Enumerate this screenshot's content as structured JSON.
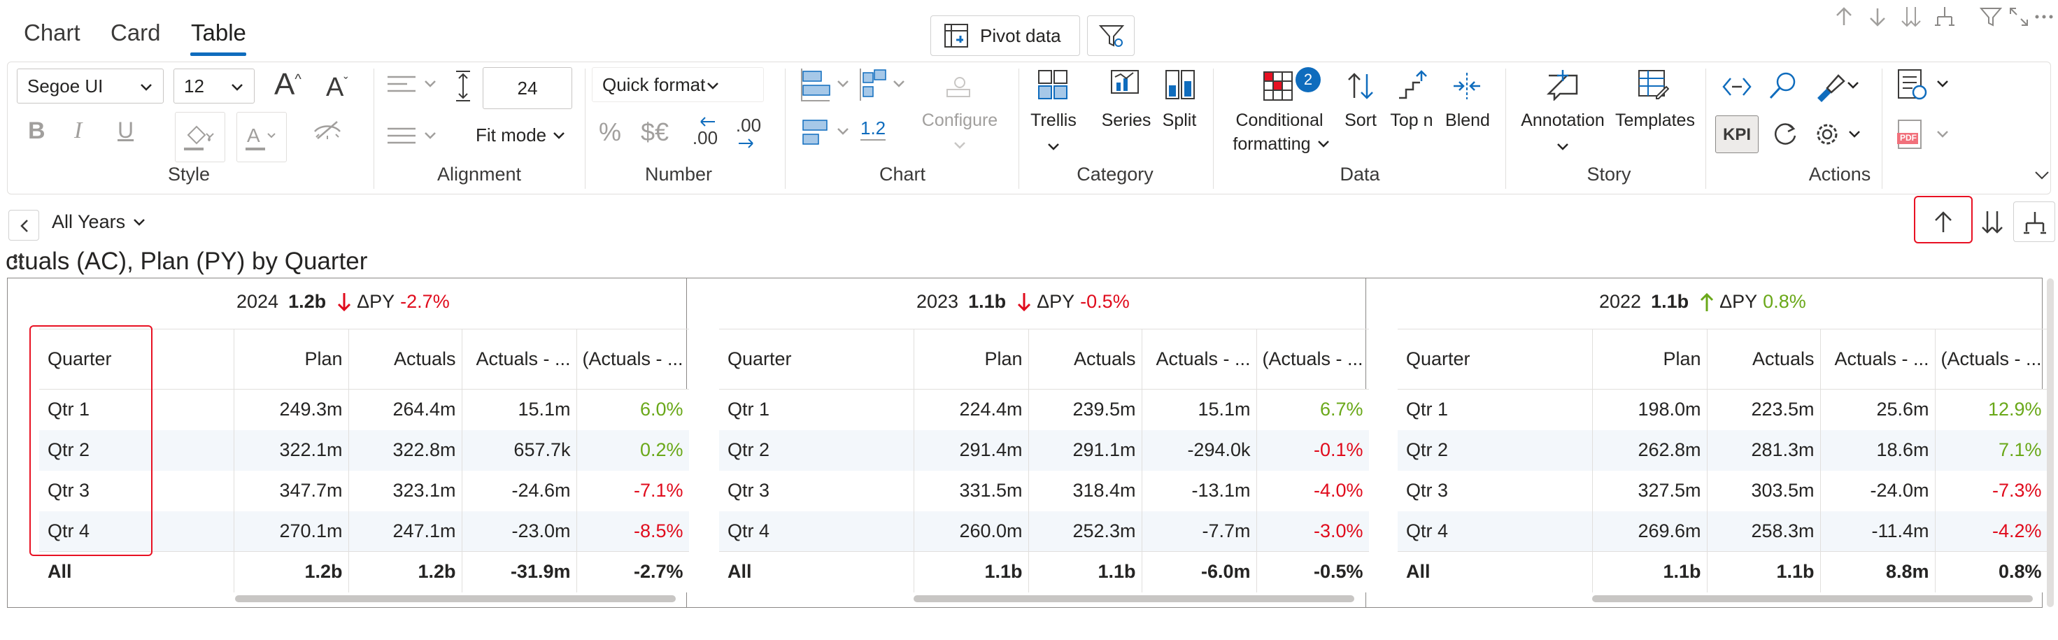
{
  "tabs": [
    {
      "label": "Chart",
      "active": false
    },
    {
      "label": "Card",
      "active": false
    },
    {
      "label": "Table",
      "active": true
    }
  ],
  "top_toolbar": {
    "pivot_label": "Pivot data",
    "tiny_icons": [
      "arrow-up-icon",
      "arrow-down-icon",
      "sort-down-icon",
      "hierarchy-icon",
      "filter-icon",
      "expand-icon",
      "more-icon"
    ]
  },
  "ribbon": {
    "style": {
      "label": "Style",
      "font_family": "Segoe UI",
      "font_size": "12",
      "bold": "B",
      "italic": "I",
      "underline": "U"
    },
    "alignment": {
      "label": "Alignment",
      "row_height": "24",
      "fit_mode": "Fit mode"
    },
    "number": {
      "label": "Number",
      "quick_format": "Quick format",
      "percent": "%",
      "currency": "$€",
      "dec_less": ".00",
      "dec_more": ".00"
    },
    "chart": {
      "label": "Chart",
      "scale_value": "1.2",
      "configure": "Configure"
    },
    "category": {
      "label": "Category",
      "trellis": "Trellis",
      "series": "Series",
      "split": "Split"
    },
    "data": {
      "label": "Data",
      "cond_line1": "Conditional",
      "cond_line2": "formatting",
      "cond_badge": "2",
      "sort": "Sort",
      "top_n": "Top n",
      "blend": "Blend"
    },
    "story": {
      "label": "Story",
      "annotation": "Annotation",
      "templates": "Templates"
    },
    "actions": {
      "label": "Actions",
      "kpi": "KPI",
      "pdf": "PDF"
    }
  },
  "nav": {
    "years_dropdown": "All Years"
  },
  "chart_title": "ctuals (AC), Plan (PY) by Quarter",
  "columns": [
    "Quarter",
    "Plan",
    "Actuals",
    "Actuals - ...",
    "(Actuals - ..."
  ],
  "panels": [
    {
      "year": "2024",
      "total": "1.2b",
      "delta_label": "ΔPY",
      "delta_value": "-2.7%",
      "delta_dir": "down",
      "rows": [
        {
          "quarter": "Qtr 1",
          "plan": "249.3m",
          "actuals": "264.4m",
          "diff": "15.1m",
          "pct": "6.0%",
          "sign": "pos"
        },
        {
          "quarter": "Qtr 2",
          "plan": "322.1m",
          "actuals": "322.8m",
          "diff": "657.7k",
          "pct": "0.2%",
          "sign": "pos"
        },
        {
          "quarter": "Qtr 3",
          "plan": "347.7m",
          "actuals": "323.1m",
          "diff": "-24.6m",
          "pct": "-7.1%",
          "sign": "neg"
        },
        {
          "quarter": "Qtr 4",
          "plan": "270.1m",
          "actuals": "247.1m",
          "diff": "-23.0m",
          "pct": "-8.5%",
          "sign": "neg"
        }
      ],
      "total_row": {
        "quarter": "All",
        "plan": "1.2b",
        "actuals": "1.2b",
        "diff": "-31.9m",
        "pct": "-2.7%"
      }
    },
    {
      "year": "2023",
      "total": "1.1b",
      "delta_label": "ΔPY",
      "delta_value": "-0.5%",
      "delta_dir": "down",
      "rows": [
        {
          "quarter": "Qtr 1",
          "plan": "224.4m",
          "actuals": "239.5m",
          "diff": "15.1m",
          "pct": "6.7%",
          "sign": "pos"
        },
        {
          "quarter": "Qtr 2",
          "plan": "291.4m",
          "actuals": "291.1m",
          "diff": "-294.0k",
          "pct": "-0.1%",
          "sign": "neg"
        },
        {
          "quarter": "Qtr 3",
          "plan": "331.5m",
          "actuals": "318.4m",
          "diff": "-13.1m",
          "pct": "-4.0%",
          "sign": "neg"
        },
        {
          "quarter": "Qtr 4",
          "plan": "260.0m",
          "actuals": "252.3m",
          "diff": "-7.7m",
          "pct": "-3.0%",
          "sign": "neg"
        }
      ],
      "total_row": {
        "quarter": "All",
        "plan": "1.1b",
        "actuals": "1.1b",
        "diff": "-6.0m",
        "pct": "-0.5%"
      }
    },
    {
      "year": "2022",
      "total": "1.1b",
      "delta_label": "ΔPY",
      "delta_value": "0.8%",
      "delta_dir": "up",
      "rows": [
        {
          "quarter": "Qtr 1",
          "plan": "198.0m",
          "actuals": "223.5m",
          "diff": "25.6m",
          "pct": "12.9%",
          "sign": "pos"
        },
        {
          "quarter": "Qtr 2",
          "plan": "262.8m",
          "actuals": "281.3m",
          "diff": "18.6m",
          "pct": "7.1%",
          "sign": "pos"
        },
        {
          "quarter": "Qtr 3",
          "plan": "327.5m",
          "actuals": "303.5m",
          "diff": "-24.0m",
          "pct": "-7.3%",
          "sign": "neg"
        },
        {
          "quarter": "Qtr 4",
          "plan": "269.6m",
          "actuals": "258.3m",
          "diff": "-11.4m",
          "pct": "-4.2%",
          "sign": "neg"
        }
      ],
      "total_row": {
        "quarter": "All",
        "plan": "1.1b",
        "actuals": "1.1b",
        "diff": "8.8m",
        "pct": "0.8%"
      }
    }
  ],
  "colors": {
    "accent": "#0f6cbd",
    "negative": "#e00b1c",
    "positive": "#6aa819",
    "highlight": "#e81123"
  }
}
